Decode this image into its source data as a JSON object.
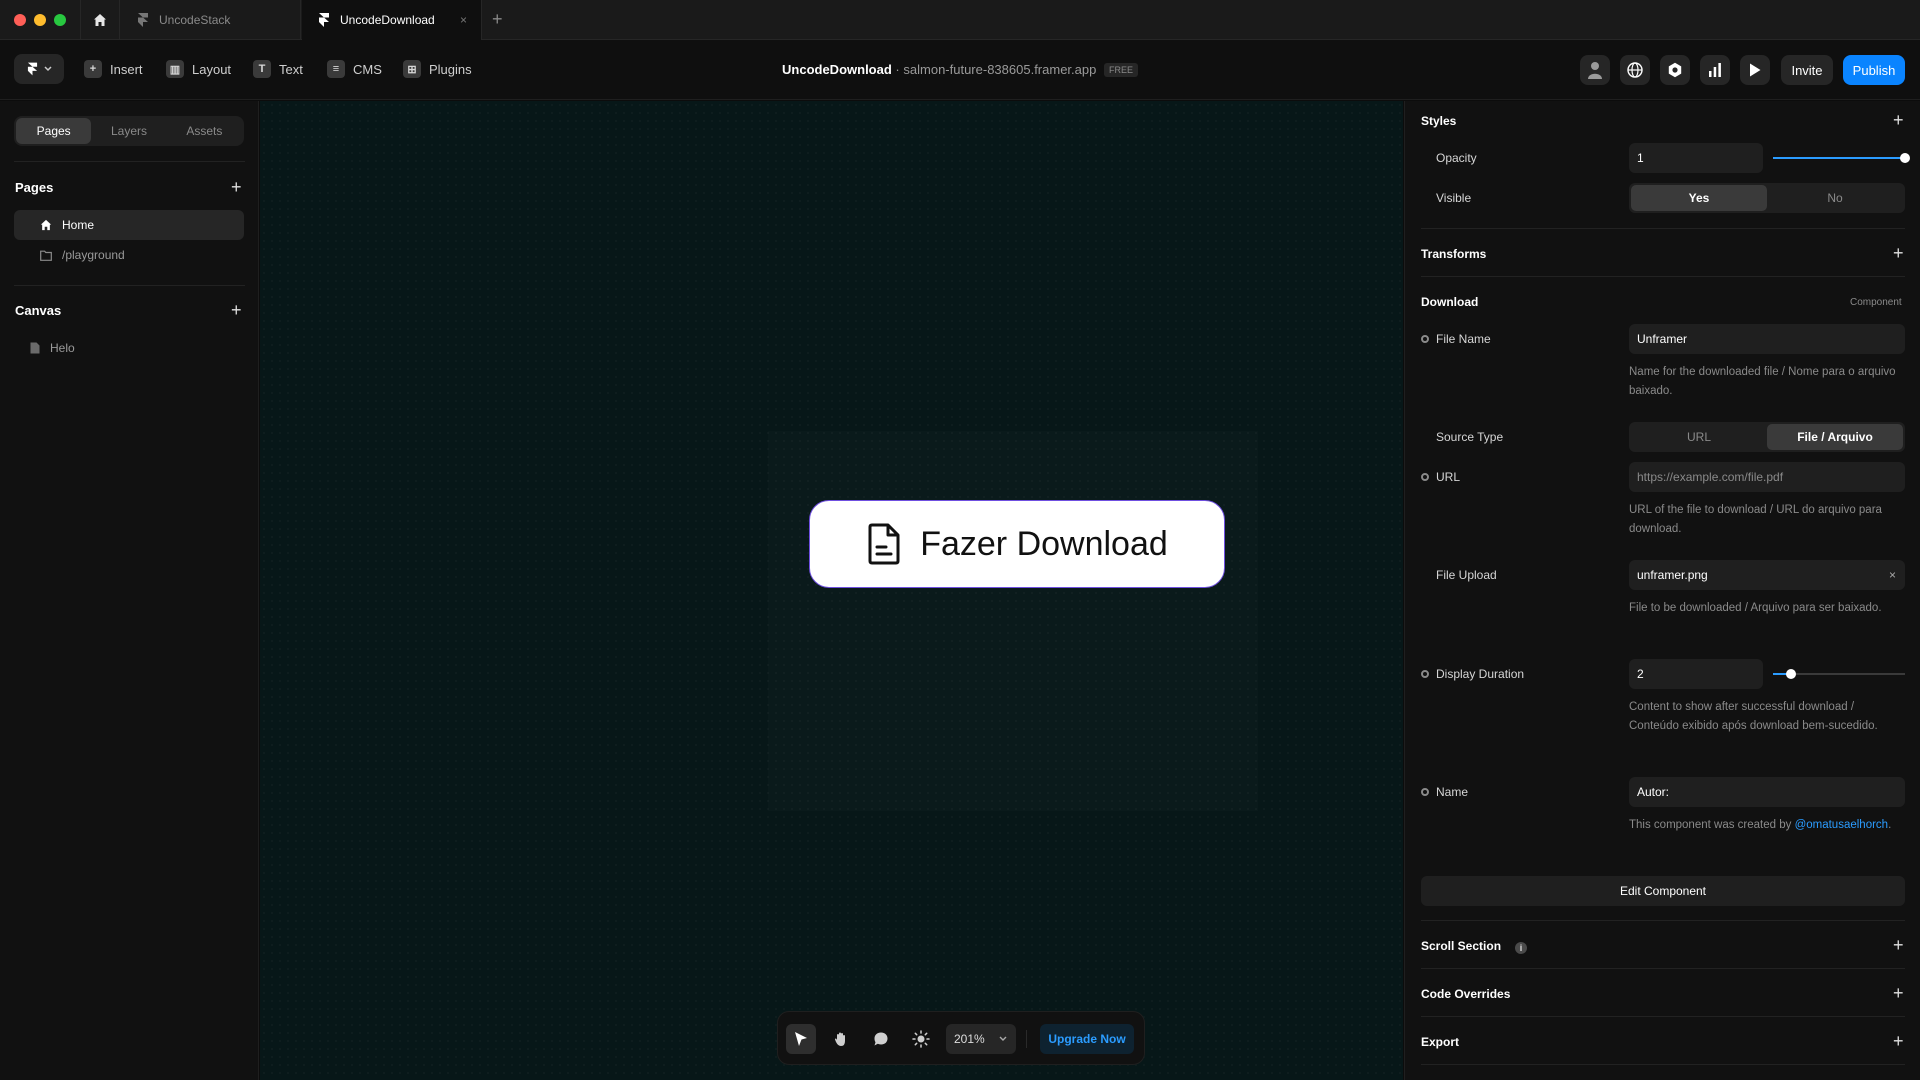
{
  "window": {
    "tabs": [
      {
        "label": "UncodeStack",
        "active": false
      },
      {
        "label": "UncodeDownload",
        "active": true
      }
    ],
    "new_tab": "+",
    "close": "×"
  },
  "toolbar": {
    "insert": "Insert",
    "layout": "Layout",
    "text": "Text",
    "cms": "CMS",
    "plugins": "Plugins",
    "project_name": "UncodeDownload",
    "separator": "·",
    "domain": "salmon-future-838605.framer.app",
    "plan_badge": "FREE",
    "invite": "Invite",
    "publish": "Publish"
  },
  "left_panel": {
    "tabs": [
      "Pages",
      "Layers",
      "Assets"
    ],
    "pages_title": "Pages",
    "pages": [
      {
        "label": "Home",
        "icon": "home-icon",
        "selected": true
      },
      {
        "label": "/playground",
        "icon": "folder-icon",
        "selected": false
      }
    ],
    "canvas_title": "Canvas",
    "canvas_items": [
      {
        "label": "Helo",
        "icon": "file-icon"
      }
    ]
  },
  "canvas": {
    "button_label": "Fazer Download",
    "zoom": "201%",
    "upgrade": "Upgrade Now"
  },
  "right_panel": {
    "styles": {
      "title": "Styles",
      "opacity_label": "Opacity",
      "opacity_value": "1",
      "opacity_level": 1.0,
      "visible_label": "Visible",
      "visible_yes": "Yes",
      "visible_no": "No"
    },
    "transforms": {
      "title": "Transforms"
    },
    "download": {
      "title": "Download",
      "tag": "Component",
      "file_name_label": "File Name",
      "file_name_value": "Unframer",
      "file_name_help": "Name for the downloaded file / Nome para o arquivo baixado.",
      "source_type_label": "Source Type",
      "source_url": "URL",
      "source_file": "File / Arquivo",
      "url_label": "URL",
      "url_placeholder": "https://example.com/file.pdf",
      "url_help": "URL of the file to download / URL do arquivo para download.",
      "file_upload_label": "File Upload",
      "file_upload_value": "unframer.png",
      "file_upload_clear": "×",
      "file_upload_help": "File to be downloaded / Arquivo para ser baixado.",
      "display_duration_label": "Display Duration",
      "display_duration_value": "2",
      "display_duration_level": 0.14,
      "display_duration_help": "Content to show after successful download / Conteúdo exibido após download bem-sucedido.",
      "name_label": "Name",
      "name_value": "Autor:",
      "name_help_prefix": "This component was created by",
      "name_help_link": "@omatusaelhorch",
      "name_help_suffix": ".",
      "edit_component": "Edit Component"
    },
    "scroll_section": {
      "title": "Scroll Section",
      "info": "i"
    },
    "code_overrides": {
      "title": "Code Overrides"
    },
    "export": {
      "title": "Export"
    },
    "plus": "+"
  }
}
